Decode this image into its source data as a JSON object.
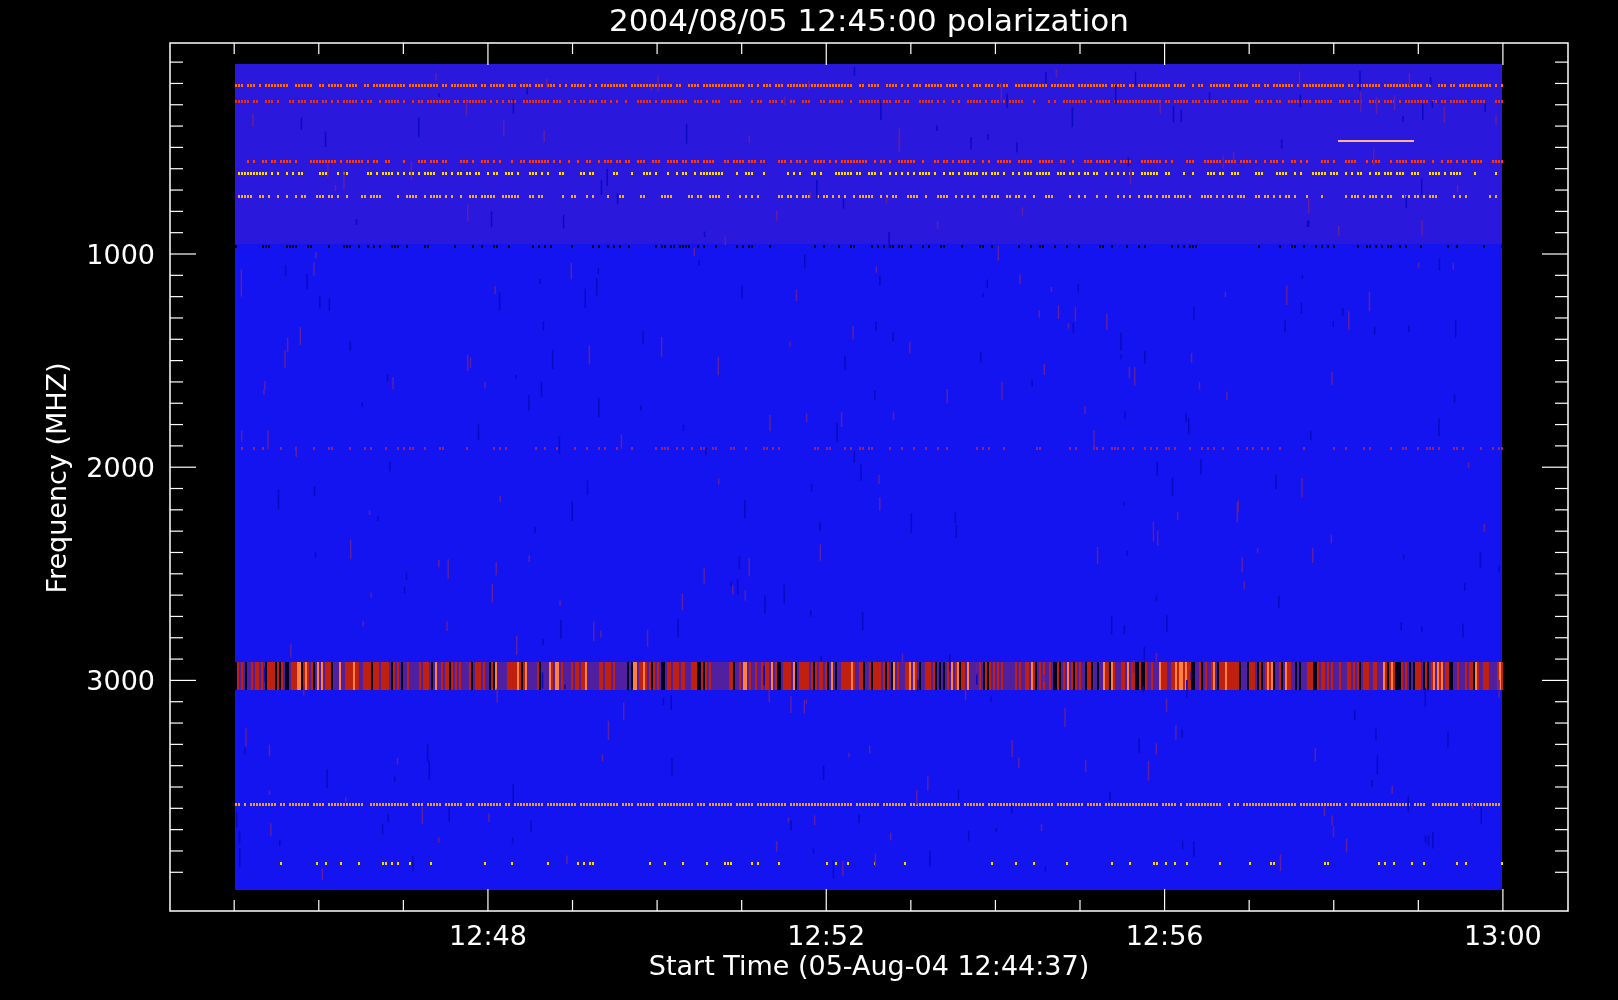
{
  "title": "2004/08/05 12:45:00 polarization",
  "y_axis": {
    "label": "Frequency (MHZ)",
    "ticks": [
      "1000",
      "2000",
      "3000"
    ]
  },
  "x_axis": {
    "label": "Start Time (05-Aug-04 12:44:37)",
    "ticks": [
      "12:48",
      "12:52",
      "12:56",
      "13:00"
    ]
  }
}
